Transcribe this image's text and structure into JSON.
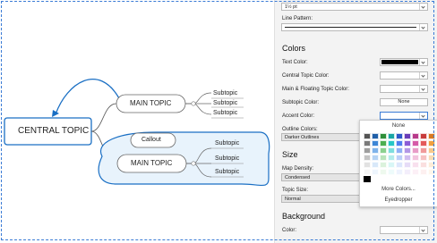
{
  "mindmap": {
    "central": "CENTRAL TOPIC",
    "main1": "MAIN TOPIC",
    "main2": "MAIN TOPIC",
    "callout": "Callout",
    "subtopics1": [
      "Subtopic",
      "Subtopic",
      "Subtopic"
    ],
    "subtopics2": [
      "Subtopic",
      "Subtopic",
      "Subtopic"
    ],
    "line_color": "#1a6fc4"
  },
  "panel": {
    "line_width": "1½ pt",
    "line_pattern_label": "Line Pattern:",
    "colors_header": "Colors",
    "text_color_label": "Text Color:",
    "text_color_value": "#000000",
    "central_topic_color_label": "Central Topic Color:",
    "main_floating_color_label": "Main & Floating Topic Color:",
    "subtopic_color_label": "Subtopic Color:",
    "subtopic_color_value": "None",
    "accent_color_label": "Accent Color:",
    "outline_colors_label": "Outline Colors:",
    "outline_colors_value": "Darker Outlines",
    "size_header": "Size",
    "map_density_label": "Map Density:",
    "map_density_value": "Condensed",
    "topic_size_label": "Topic Size:",
    "topic_size_value": "Normal",
    "background_header": "Background",
    "bg_color_label": "Color:"
  },
  "popup": {
    "none_label": "None",
    "more_colors": "More Colors...",
    "eyedropper": "Eyedropper",
    "palette": [
      [
        "#545454",
        "#1f5fa8",
        "#2f8f3a",
        "#1aa6a6",
        "#2e58c9",
        "#6a3db8",
        "#b83a8a",
        "#c83c3c",
        "#d87a23"
      ],
      [
        "#7a7a7a",
        "#3c86d6",
        "#4caf50",
        "#26c6c6",
        "#4f7ff0",
        "#8b5cd6",
        "#d65aa8",
        "#e45a5a",
        "#f0a040"
      ],
      [
        "#9e9e9e",
        "#7fb3ea",
        "#8bd18f",
        "#7ddede",
        "#8fb0f5",
        "#b397e6",
        "#e89cc8",
        "#f09a9a",
        "#f6c88a"
      ],
      [
        "#c4c4c4",
        "#b5d3f4",
        "#b9e4bb",
        "#b2ecec",
        "#bccff9",
        "#d0bdf0",
        "#f2c3de",
        "#f6c2c2",
        "#f9dcb5"
      ],
      [
        "#e2e2e2",
        "#d8e8f9",
        "#dbf2dc",
        "#d8f6f6",
        "#dde7fc",
        "#e6dcf7",
        "#f8e0ee",
        "#fadfdf",
        "#fcecd8"
      ],
      [
        "#f4f4f4",
        "#eef5fd",
        "#eef9ee",
        "#eefbfb",
        "#eef3fe",
        "#f3eefb",
        "#fcf0f6",
        "#fdf0f0",
        "#fef6ec"
      ]
    ],
    "black": "#000000"
  }
}
